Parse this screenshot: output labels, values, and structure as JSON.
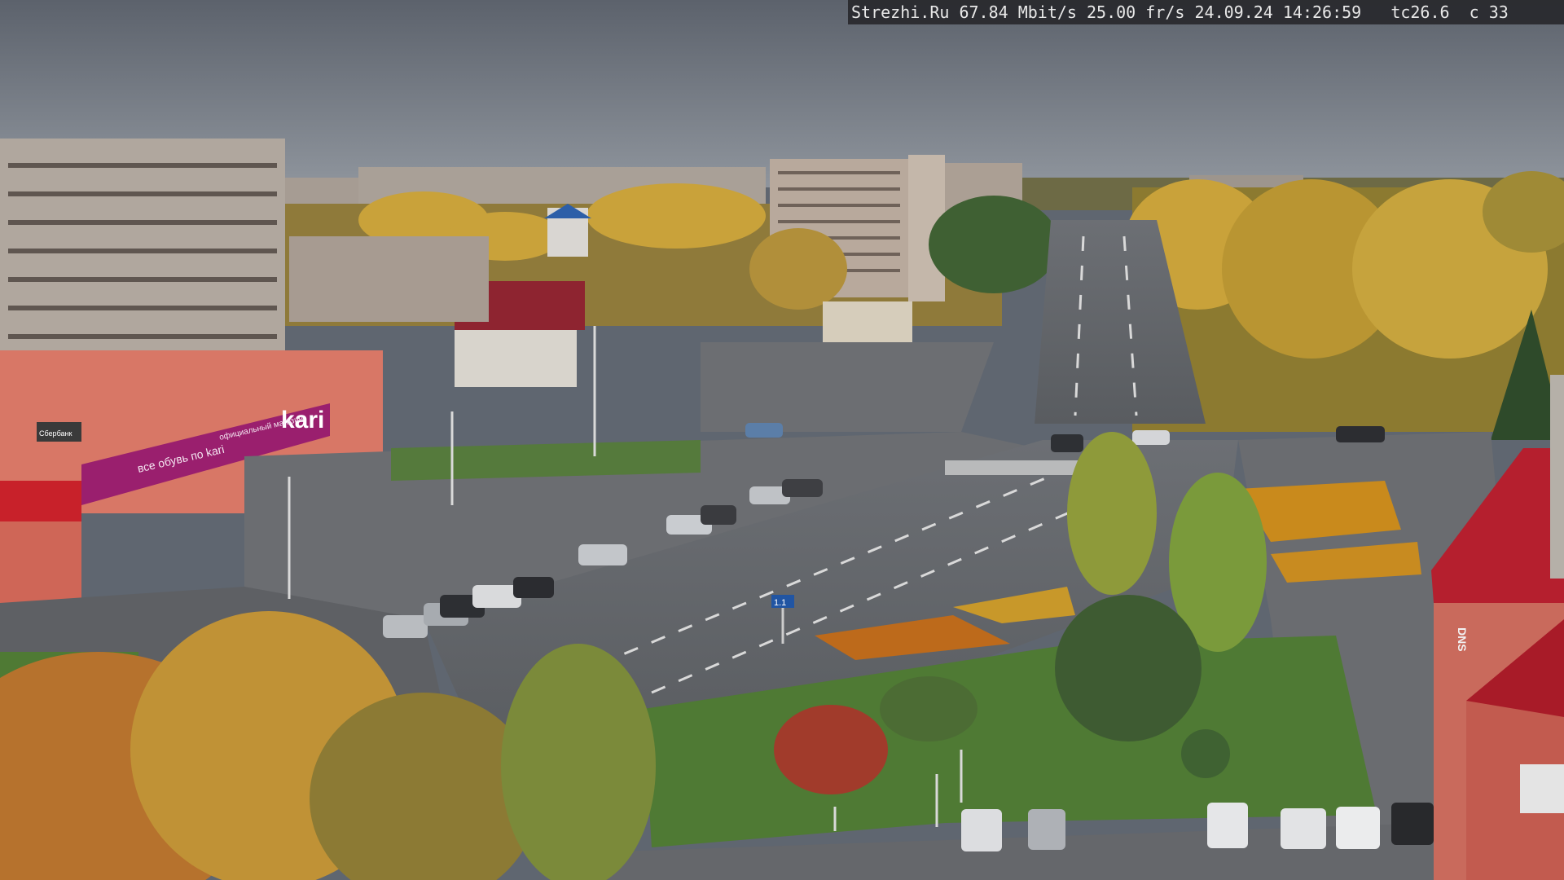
{
  "overlay": {
    "site": "Strezhi.Ru",
    "bitrate": "67.84 Mbit/s",
    "framerate": "25.00 fr/s",
    "date": "24.09.24",
    "time": "14:26:59",
    "temperature": "tc26.6",
    "channel": "c 33"
  },
  "signs": {
    "store_brand": "kari",
    "store_slogan": "все обувь по kari",
    "store_banner": "официальный магазин",
    "bank_sign": "Сбербанк",
    "road_sign": "1.1",
    "roof_sign": "DNS"
  },
  "colors": {
    "sky": "#7d838c",
    "foliage_yellow": "#c9a23a",
    "foliage_orange": "#b6722d",
    "grass": "#4f7a34",
    "asphalt": "#6a6c70",
    "kari_magenta": "#9a1f6e",
    "roof_red": "#b51f2e"
  }
}
